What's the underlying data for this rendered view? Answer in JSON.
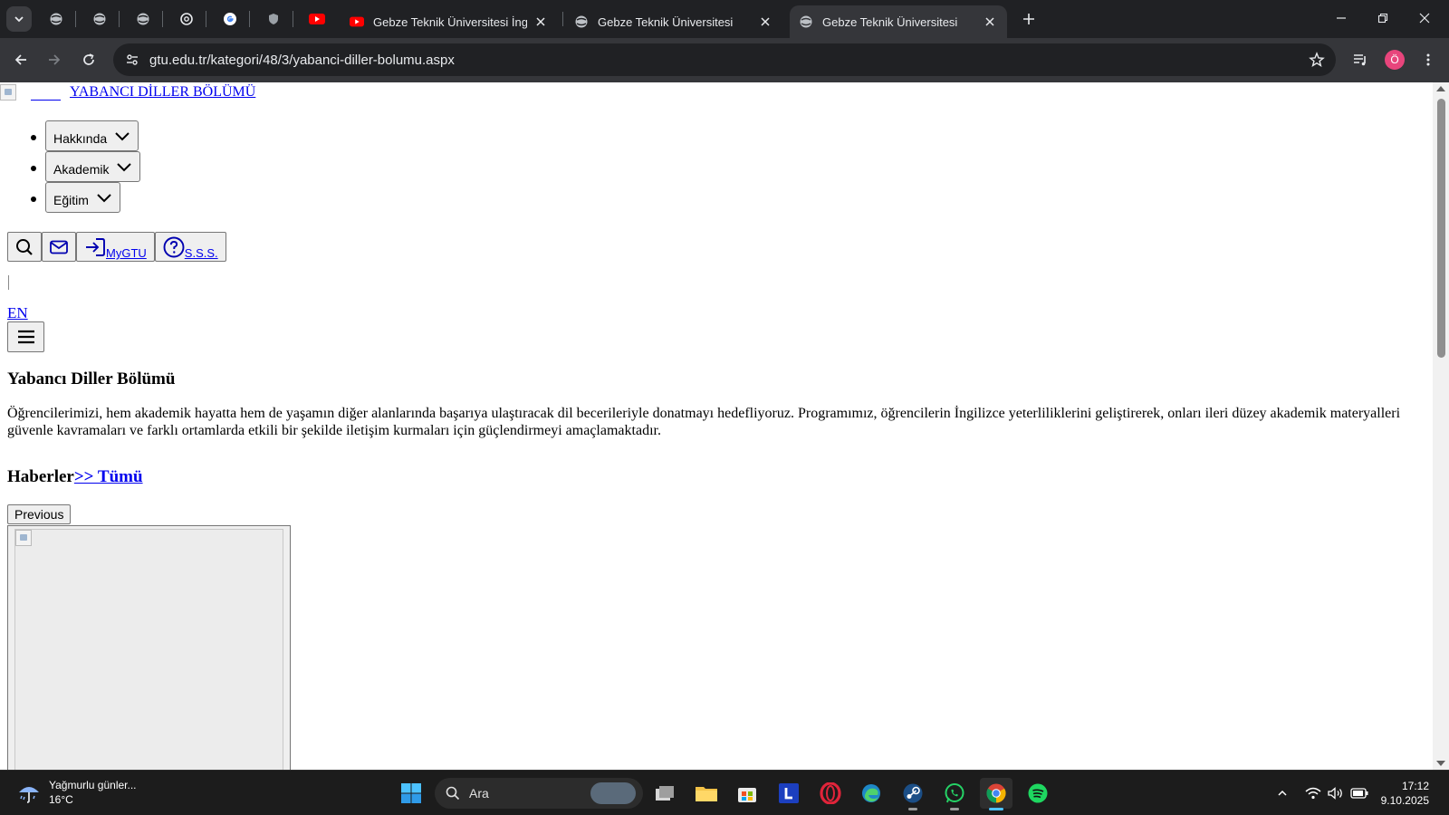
{
  "browser": {
    "tabs": [
      {
        "title": "Gebze Teknik Üniversitesi İngiliz",
        "favicon": "youtube-icon",
        "active": false
      },
      {
        "title": "Gebze Teknik Üniversitesi",
        "favicon": "globe-icon",
        "active": false
      },
      {
        "title": "Gebze Teknik Üniversitesi",
        "favicon": "globe-icon",
        "active": true
      }
    ],
    "url": "gtu.edu.tr/kategori/48/3/yabanci-diller-bolumu.aspx",
    "profile_initial": "Ö",
    "colors": {
      "frame": "#202124",
      "toolbar": "#35363a",
      "profile": "#e8457c"
    }
  },
  "page": {
    "logo_link": "YABANCI DİLLER BÖLÜMÜ",
    "menu": [
      {
        "label": "Hakkında"
      },
      {
        "label": "Akademik"
      },
      {
        "label": "Eğitim"
      }
    ],
    "quick_links": {
      "mygtu": "MyGTU",
      "sss": "S.S.S."
    },
    "lang_switch": "EN",
    "heading": "Yabancı Diller Bölümü",
    "intro": "Öğrencilerimizi, hem akademik hayatta hem de yaşamın diğer alanlarında başarıya ulaştıracak dil becerileriyle donatmayı hedefliyoruz. Programımız, öğrencilerin İngilizce yeterliliklerini geliştirerek, onları ileri düzey akademik materyalleri güvenle kavramaları ve farklı ortamlarda etkili bir şekilde iletişim kurmaları için güçlendirmeyi amaçlamaktadır.",
    "news_heading": "Haberler",
    "news_all_link": ">> Tümü",
    "carousel_prev": "Previous"
  },
  "taskbar": {
    "weather_text": "Yağmurlu günler...",
    "weather_temp": "16°C",
    "search_label": "Ara",
    "time": "17:12",
    "date": "9.10.2025"
  }
}
